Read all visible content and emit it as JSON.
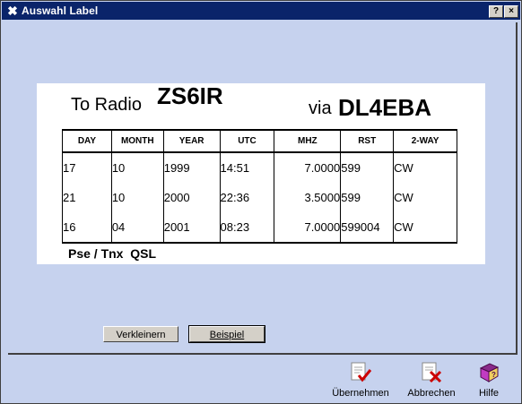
{
  "window": {
    "title": "Auswahl Label",
    "help_glyph": "?",
    "close_glyph": "×"
  },
  "label": {
    "to_radio": "To Radio",
    "callsign": "ZS6IR",
    "via": "via",
    "via_callsign": "DL4EBA",
    "columns": [
      "DAY",
      "MONTH",
      "YEAR",
      "UTC",
      "MHZ",
      "RST",
      "2-WAY"
    ],
    "rows": [
      {
        "day": "17",
        "month": "10",
        "year": "1999",
        "utc": "14:51",
        "mhz": "7.0000",
        "rst": "599",
        "mode": "CW"
      },
      {
        "day": "21",
        "month": "10",
        "year": "2000",
        "utc": "22:36",
        "mhz": "3.5000",
        "rst": "599",
        "mode": "CW"
      },
      {
        "day": "16",
        "month": "04",
        "year": "2001",
        "utc": "08:23",
        "mhz": "7.0000",
        "rst": "599004",
        "mode": "CW"
      }
    ],
    "footer_text": "Pse / Tnx  QSL"
  },
  "buttons": {
    "shrink": "Verkleinern",
    "example": "Beispiel"
  },
  "footer": {
    "accept": "Übernehmen",
    "cancel": "Abbrechen",
    "help": "Hilfe"
  },
  "icons": {
    "app": "tools-icon",
    "accept": "document-check-icon",
    "cancel": "document-x-icon",
    "help": "help-book-icon"
  },
  "colors": {
    "titlebar": "#0a246a",
    "panel": "#c6d2ee",
    "check": "#cc0000"
  }
}
